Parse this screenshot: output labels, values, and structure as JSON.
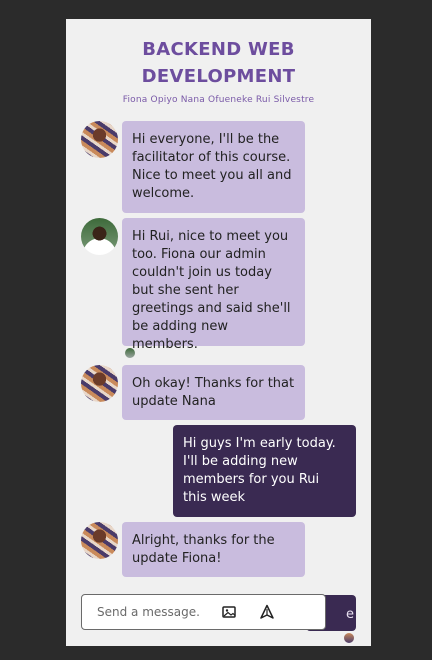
{
  "header": {
    "title_line1": "BACKEND WEB",
    "title_line2": "DEVELOPMENT",
    "members": "Fiona Opiyo Nana Ofueneke Rui Silvestre"
  },
  "messages": [
    {
      "sender": "fiona",
      "direction": "in",
      "text": "Hi everyone, I'll be the facilitator of this course. Nice to meet you all and welcome."
    },
    {
      "sender": "nana",
      "direction": "in",
      "text": "Hi Rui, nice to meet you too. Fiona our admin couldn't join us today but she sent her greetings and said she'll be adding new members."
    },
    {
      "sender": "fiona",
      "direction": "in",
      "text": "Oh okay! Thanks for that update Nana"
    },
    {
      "sender": "rui",
      "direction": "out",
      "text": "Hi guys I'm early today. I'll be adding new members for you Rui this week"
    },
    {
      "sender": "fiona",
      "direction": "in",
      "text": "Alright, thanks for the update Fiona!"
    }
  ],
  "peek_text": "e",
  "composer": {
    "placeholder": "Send a message.",
    "image_icon": "image-icon",
    "send_icon": "send-icon"
  },
  "colors": {
    "accent": "#6d4d9e",
    "incoming_bubble": "#c9bcde",
    "outgoing_bubble": "#3a2a52",
    "panel": "#f0f0f0",
    "backdrop": "#2b2b2b"
  }
}
